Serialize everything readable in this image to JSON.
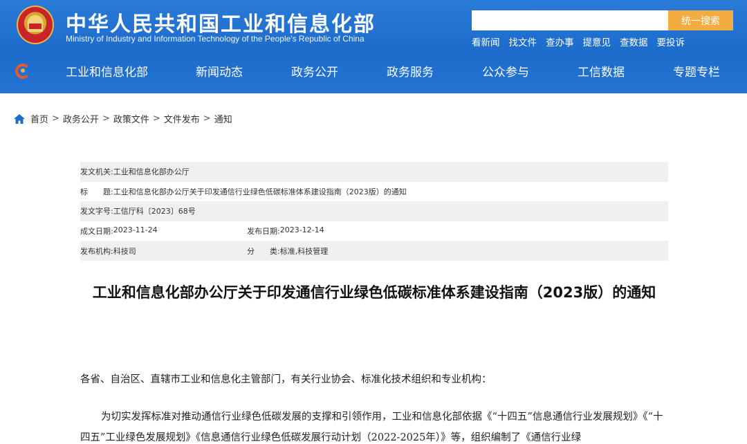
{
  "header": {
    "ministry_name_cn": "中华人民共和国工业和信息化部",
    "ministry_name_en": "Ministry of Industry and Information Technology of the People's Republic of China",
    "search": {
      "placeholder": "",
      "button_label": "统一搜索"
    },
    "quick_links": [
      "看新闻",
      "找文件",
      "查办事",
      "提意见",
      "查数据",
      "要投诉"
    ],
    "colors": {
      "header_blue": "#1d6ccb",
      "search_button": "#f2ac3f"
    },
    "emblem_icon": "national-emblem-icon"
  },
  "nav": {
    "logo_icon": "miit-logo-icon",
    "items": [
      "工业和信息化部",
      "新闻动态",
      "政务公开",
      "政务服务",
      "公众参与",
      "工信数据",
      "专题专栏"
    ]
  },
  "breadcrumb": {
    "home_icon": "home-icon",
    "items": [
      "首页",
      "政务公开",
      "政策文件",
      "文件发布",
      "通知"
    ],
    "separator": ">"
  },
  "document_info": {
    "issuer_label": "发文机关:",
    "issuer": "工业和信息化部办公厅",
    "title_label": "标　　题:",
    "title": "工业和信息化部办公厅关于印发通信行业绿色低碳标准体系建设指南（2023版）的通知",
    "doc_no_label": "发文字号:",
    "doc_no": "工信厅科〔2023〕68号",
    "created_label": "成文日期:",
    "created": "2023-11-24",
    "published_label": "发布日期:",
    "published": "2023-12-14",
    "org_label": "发布机构:",
    "org": "科技司",
    "category_label": "分　　类:",
    "category": "标准,科技管理"
  },
  "article": {
    "title": "工业和信息化部办公厅关于印发通信行业绿色低碳标准体系建设指南（2023版）的通知",
    "salutation": "各省、自治区、直辖市工业和信息化主管部门，有关行业协会、标准化技术组织和专业机构：",
    "paragraph1": "为切实发挥标准对推动通信行业绿色低碳发展的支撑和引领作用，工业和信息化部依据《“十四五”信息通信行业发展规划》《“十四五”工业绿色发展规划》《信息通信行业绿色低碳发展行动计划（2022-2025年）》等，组织编制了《通信行业绿"
  }
}
